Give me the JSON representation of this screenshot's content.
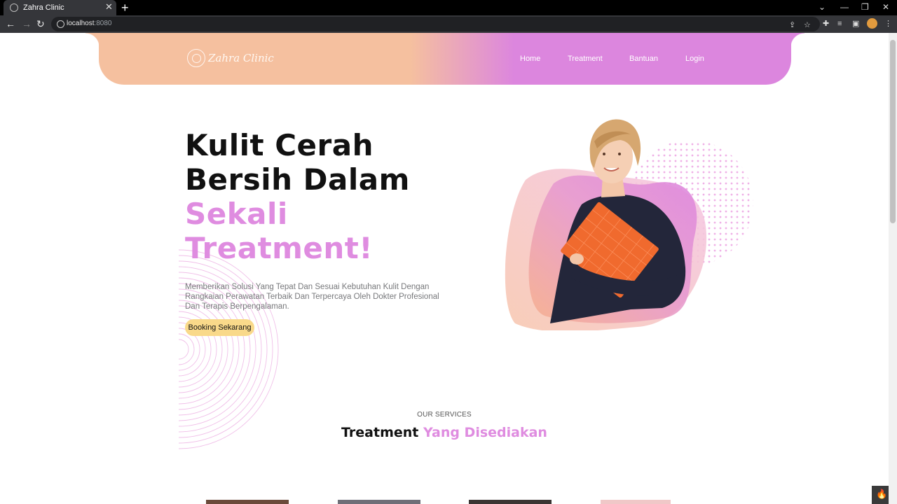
{
  "browser": {
    "tab_title": "Zahra Clinic",
    "tab_close": "✕",
    "new_tab": "+",
    "url_host": "localhost",
    "url_port": ":8080",
    "window_controls": [
      "⌄",
      "—",
      "❐",
      "✕"
    ]
  },
  "navbar": {
    "logo_text": "Zahra Clinic",
    "links": [
      "Home",
      "Treatment",
      "Bantuan",
      "Login"
    ]
  },
  "hero": {
    "line1": "Kulit Cerah",
    "line2": "Bersih Dalam",
    "line3": "Sekali",
    "line4": "Treatment!",
    "description": "Memberikan Solusi Yang Tepat Dan Sesuai Kebutuhan Kulit Dengan Rangkaian Perawatan Terbaik Dan Terpercaya Oleh Dokter Profesional Dan Terapis Berpengalaman.",
    "cta": "Booking Sekarang"
  },
  "services": {
    "eyebrow": "OUR SERVICES",
    "title_dark": "Treatment ",
    "title_pink": "Yang Disediakan"
  },
  "colors": {
    "navbar_peach": "#f5c09f",
    "navbar_pink": "#dc86de",
    "accent_pink": "#df8ce0",
    "cta_yellow": "#f9d98a"
  },
  "icons": [
    "back-icon",
    "forward-icon",
    "reload-icon",
    "info-icon",
    "share-icon",
    "star-icon",
    "extensions-icon",
    "reading-list-icon",
    "sidepanel-icon",
    "menu-icon",
    "fire-icon"
  ]
}
